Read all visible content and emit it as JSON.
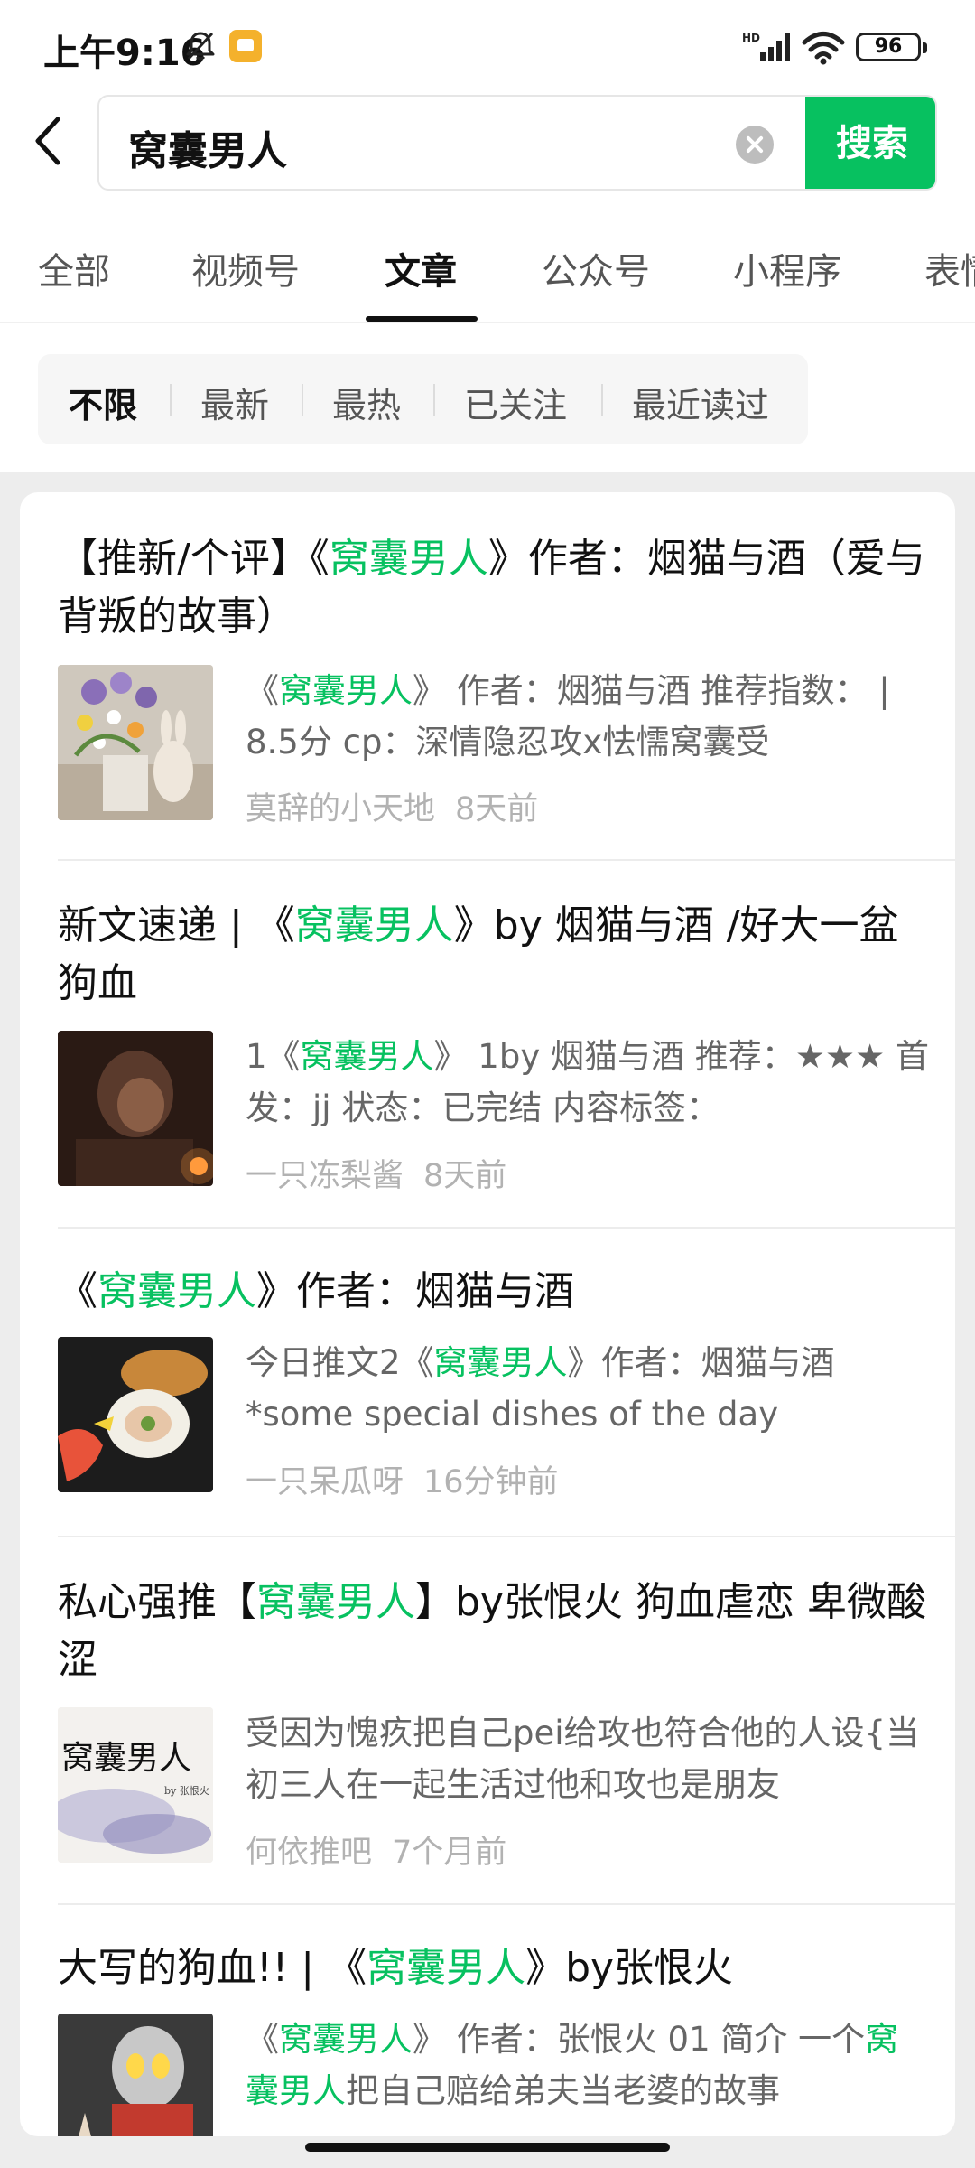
{
  "status_bar": {
    "time": "上午9:16",
    "battery": "96"
  },
  "search": {
    "query": "窝囊男人",
    "button_label": "搜索"
  },
  "tabs": [
    {
      "label": "全部"
    },
    {
      "label": "视频号"
    },
    {
      "label": "文章"
    },
    {
      "label": "公众号"
    },
    {
      "label": "小程序"
    },
    {
      "label": "表情"
    }
  ],
  "active_tab": "文章",
  "filters": [
    {
      "label": "不限"
    },
    {
      "label": "最新"
    },
    {
      "label": "最热"
    },
    {
      "label": "已关注"
    },
    {
      "label": "最近读过"
    }
  ],
  "active_filter": "不限",
  "results": [
    {
      "title": [
        {
          "text": "【推新/个评】《"
        },
        {
          "text": "窝囊男人",
          "hl": true
        },
        {
          "text": "》作者：烟猫与酒（爱与背叛的故事）"
        }
      ],
      "snippet": [
        {
          "text": "《"
        },
        {
          "text": "窝囊男人",
          "hl": true
        },
        {
          "text": "》 作者：烟猫与酒 推荐指数： | 8.5分 cp：深情隐忍攻x怯懦窝囊受"
        }
      ],
      "source": "莫辞的小天地",
      "time": "8天前",
      "thumb": "flowers-and-bunny-photo"
    },
    {
      "title": [
        {
          "text": "新文速递 | 《"
        },
        {
          "text": "窝囊男人",
          "hl": true
        },
        {
          "text": "》by 烟猫与酒 /好大一盆狗血"
        }
      ],
      "snippet": [
        {
          "text": "1《"
        },
        {
          "text": "窝囊男人",
          "hl": true
        },
        {
          "text": "》 1by 烟猫与酒 推荐：★★★ 首发：jj 状态：已完结 内容标签："
        }
      ],
      "source": "一只冻梨酱",
      "time": "8天前",
      "thumb": "candlelit-portrait-photo"
    },
    {
      "title": [
        {
          "text": "《"
        },
        {
          "text": "窝囊男人",
          "hl": true
        },
        {
          "text": "》作者：烟猫与酒"
        }
      ],
      "snippet": [
        {
          "text": "今日推文2《"
        },
        {
          "text": "窝囊男人",
          "hl": true
        },
        {
          "text": "》作者：烟猫与酒 *some special dishes of the day"
        }
      ],
      "source": "一只呆瓜呀",
      "time": "16分钟前",
      "thumb": "sushi-roll-photo"
    },
    {
      "title": [
        {
          "text": "私心强推【"
        },
        {
          "text": "窝囊男人",
          "hl": true
        },
        {
          "text": "】by张恨火 狗血虐恋 卑微酸涩"
        }
      ],
      "snippet": [
        {
          "text": "受因为愧疚把自己pei给攻也符合他的人设{当初三人在一起生活过他和攻也是朋友"
        }
      ],
      "source": "何依推吧",
      "time": "7个月前",
      "thumb": "calligraphy-cover-image",
      "thumb_text": "窝囊男人",
      "thumb_sub": "by 张恨火"
    },
    {
      "title": [
        {
          "text": "大写的狗血!! | 《"
        },
        {
          "text": "窝囊男人",
          "hl": true
        },
        {
          "text": "》by张恨火"
        }
      ],
      "snippet": [
        {
          "text": "《"
        },
        {
          "text": "窝囊男人",
          "hl": true
        },
        {
          "text": "》 作者：张恨火 01 简介 一个"
        },
        {
          "text": "窝囊男人",
          "hl": true
        },
        {
          "text": "把自己赔给弟夫当老婆的故事"
        }
      ],
      "source": "",
      "time": "",
      "thumb": "ultraman-figure-photo"
    }
  ]
}
